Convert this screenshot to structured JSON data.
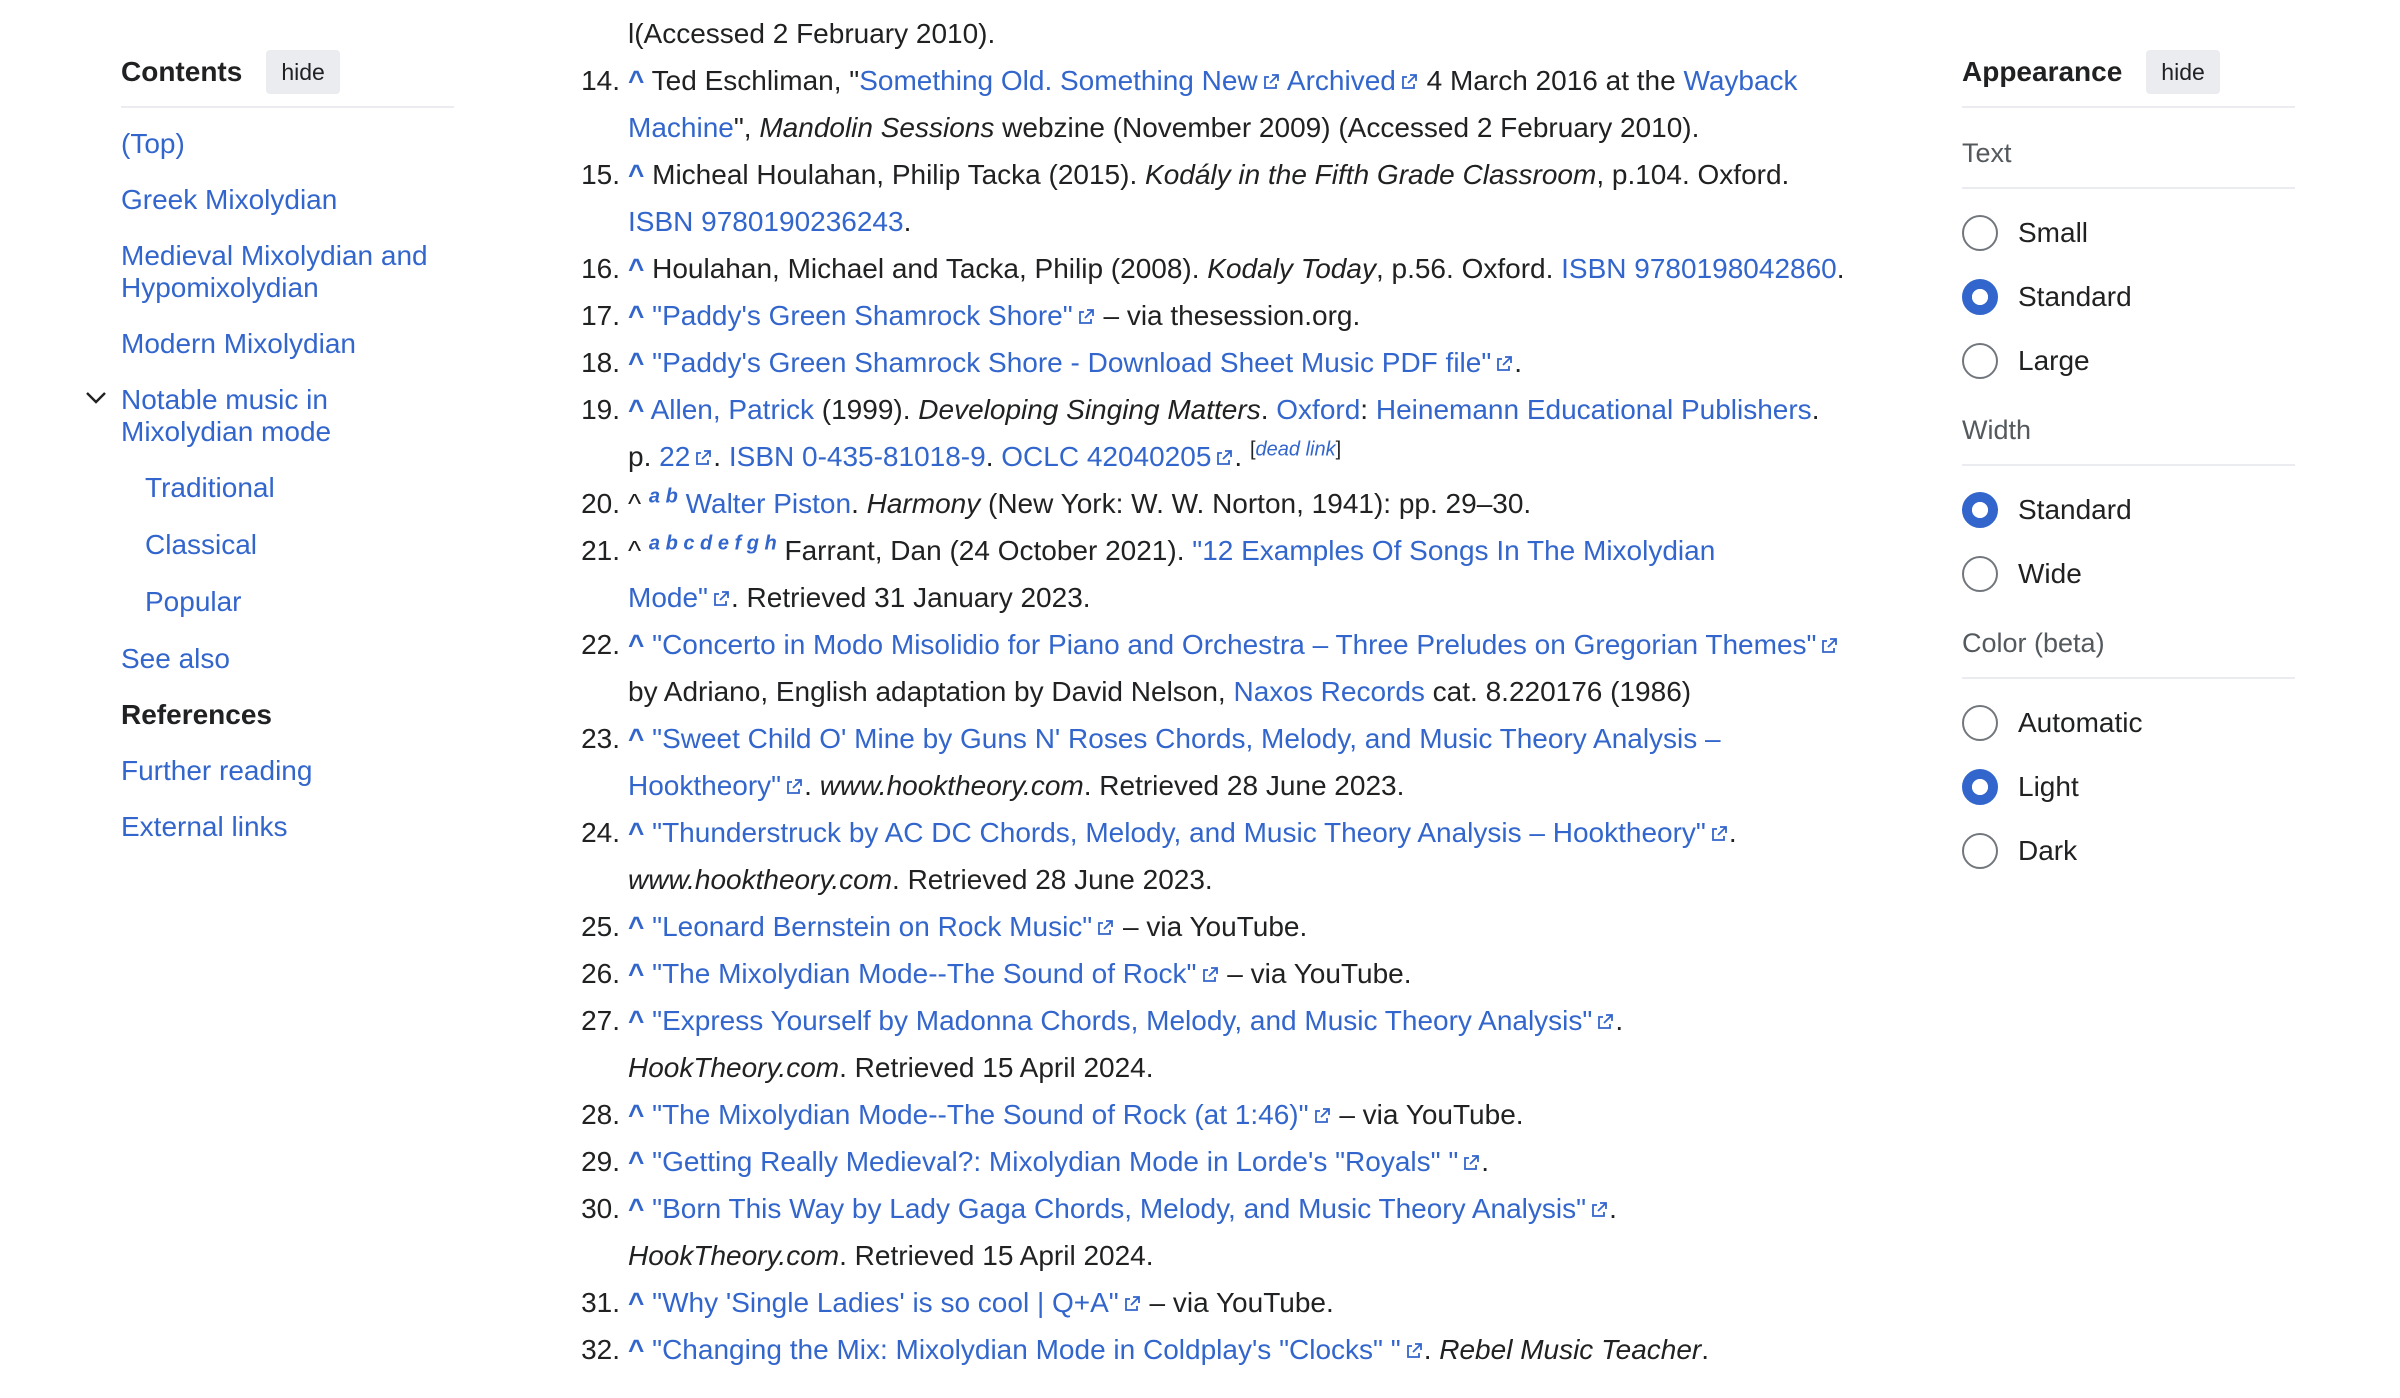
{
  "toc": {
    "title": "Contents",
    "hide_label": "hide",
    "items": [
      {
        "label": "(Top)"
      },
      {
        "label": "Greek Mixolydian"
      },
      {
        "label": "Medieval Mixolydian and Hypomixolydian"
      },
      {
        "label": "Modern Mixolydian"
      },
      {
        "label": "Notable music in Mixolydian mode"
      },
      {
        "label": "Traditional"
      },
      {
        "label": "Classical"
      },
      {
        "label": "Popular"
      },
      {
        "label": "See also"
      },
      {
        "label": "References"
      },
      {
        "label": "Further reading"
      },
      {
        "label": "External links"
      }
    ],
    "toggle_icon": "chevron-down-icon"
  },
  "refs": {
    "r13": {
      "tail": "l(Accessed 2 February 2010)."
    },
    "r14": {
      "num": "14.",
      "a": "Ted Eschliman, \"",
      "link1": "Something Old. Something New",
      "link2": "Archived",
      "b": " 4 March 2016 at the ",
      "link3": "Wayback",
      "link4": "Machine",
      "c": "\", ",
      "d_em": "Mandolin Sessions",
      "e": " webzine (November 2009) (Accessed 2 February 2010)."
    },
    "r15": {
      "num": "15.",
      "a": "Micheal Houlahan, Philip Tacka (2015). ",
      "b_em": "Kodály in the Fifth Grade Classroom",
      "c": ", p.104. Oxford.",
      "link1": "ISBN 9780190236243",
      "d": "."
    },
    "r16": {
      "num": "16.",
      "a": "Houlahan, Michael and Tacka, Philip (2008). ",
      "b_em": "Kodaly Today",
      "c": ", p.56. Oxford. ",
      "link1": "ISBN 9780198042860",
      "d": "."
    },
    "r17": {
      "num": "17.",
      "link1": "\"Paddy's Green Shamrock Shore\"",
      "a": " – via thesession.org."
    },
    "r18": {
      "num": "18.",
      "link1": "\"Paddy's Green Shamrock Shore - Download Sheet Music PDF file\"",
      "a": "."
    },
    "r19": {
      "num": "19.",
      "link1": "Allen, Patrick",
      "a": " (1999). ",
      "b_em": "Developing Singing Matters",
      "c": ". ",
      "link2": "Oxford",
      "d": ": ",
      "link3": "Heinemann Educational Publishers",
      "e": ".",
      "f": "p. ",
      "link4": "22",
      "g": ". ",
      "link5": "ISBN 0-435-81018-9",
      "h": ". ",
      "link6": "OCLC 42040205",
      "i": ". ",
      "dead_open": "[",
      "dead_link": "dead link",
      "dead_close": "]"
    },
    "r20": {
      "num": "20.",
      "caret": "^",
      "sups": "a b",
      "link1": "Walter Piston",
      "a": ". ",
      "b_em": "Harmony",
      "c": " (New York: W. W. Norton, 1941): pp. 29–30."
    },
    "r21": {
      "num": "21.",
      "caret": "^",
      "sups": "a b c d e f g h",
      "a": " Farrant, Dan (24 October 2021). ",
      "link1": "\"12 Examples Of Songs In The Mixolydian",
      "link2": "Mode\"",
      "b": ". Retrieved 31 January 2023."
    },
    "r22": {
      "num": "22.",
      "link1": "\"Concerto in Modo Misolidio for Piano and Orchestra – Three Preludes on Gregorian Themes\"",
      "a": "by Adriano, English adaptation by David Nelson, ",
      "link2": "Naxos Records",
      "b": " cat. 8.220176 (1986)"
    },
    "r23": {
      "num": "23.",
      "link1": "\"Sweet Child O' Mine by Guns N' Roses Chords, Melody, and Music Theory Analysis –",
      "link2": "Hooktheory\"",
      "a": ". ",
      "b_em": "www.hooktheory.com",
      "c": ". Retrieved 28 June 2023."
    },
    "r24": {
      "num": "24.",
      "link1": "\"Thunderstruck by AC DC Chords, Melody, and Music Theory Analysis – Hooktheory\"",
      "a": ".",
      "b_em": "www.hooktheory.com",
      "c": ". Retrieved 28 June 2023."
    },
    "r25": {
      "num": "25.",
      "link1": "\"Leonard Bernstein on Rock Music\"",
      "a": " – via YouTube."
    },
    "r26": {
      "num": "26.",
      "link1": "\"The Mixolydian Mode--The Sound of Rock\"",
      "a": " – via YouTube."
    },
    "r27": {
      "num": "27.",
      "link1": "\"Express Yourself by Madonna Chords, Melody, and Music Theory Analysis\"",
      "a": ".",
      "b_em": "HookTheory.com",
      "c": ". Retrieved 15 April 2024."
    },
    "r28": {
      "num": "28.",
      "link1": "\"The Mixolydian Mode--The Sound of Rock (at 1:46)\"",
      "a": " – via YouTube."
    },
    "r29": {
      "num": "29.",
      "link1": "\"Getting Really Medieval?: Mixolydian Mode in Lorde's \"Royals\" \"",
      "a": "."
    },
    "r30": {
      "num": "30.",
      "link1": "\"Born This Way by Lady Gaga Chords, Melody, and Music Theory Analysis\"",
      "a": ".",
      "b_em": "HookTheory.com",
      "c": ". Retrieved 15 April 2024."
    },
    "r31": {
      "num": "31.",
      "link1": "\"Why 'Single Ladies' is so cool | Q+A\"",
      "a": " – via YouTube."
    },
    "r32": {
      "num": "32.",
      "link1": "\"Changing the Mix: Mixolydian Mode in Coldplay's \"Clocks\" \"",
      "a": ". ",
      "b_em": "Rebel Music Teacher",
      "c": "."
    },
    "caret": "^"
  },
  "appearance": {
    "title": "Appearance",
    "hide_label": "hide",
    "text_label": "Text",
    "text_options": [
      "Small",
      "Standard",
      "Large"
    ],
    "text_selected": "Standard",
    "width_label": "Width",
    "width_options": [
      "Standard",
      "Wide"
    ],
    "width_selected": "Standard",
    "color_label": "Color (beta)",
    "color_options": [
      "Automatic",
      "Light",
      "Dark"
    ],
    "color_selected": "Light"
  },
  "colors": {
    "link": "#3366cc",
    "text": "#202122",
    "radio_on": "#3366cc"
  },
  "icons": {
    "external": "external-link-icon"
  }
}
